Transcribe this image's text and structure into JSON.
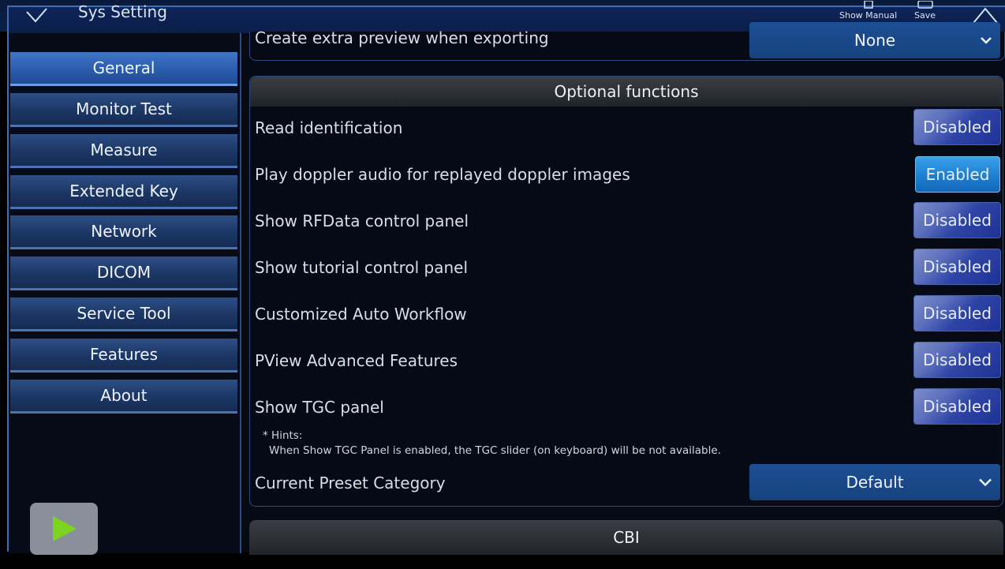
{
  "window": {
    "title": "Sys Setting",
    "show_manual_label": "Show Manual",
    "save_label": "Save"
  },
  "sidebar": {
    "items": [
      {
        "label": "General",
        "active": true
      },
      {
        "label": "Monitor Test"
      },
      {
        "label": "Measure"
      },
      {
        "label": "Extended Key"
      },
      {
        "label": "Network"
      },
      {
        "label": "DICOM"
      },
      {
        "label": "Service Tool"
      },
      {
        "label": "Features"
      },
      {
        "label": "About"
      }
    ]
  },
  "export_row": {
    "label": "Create extra preview when exporting",
    "value": "None"
  },
  "optional_functions": {
    "header": "Optional functions",
    "rows": [
      {
        "label": "Read identification",
        "state": "Disabled"
      },
      {
        "label": "Play doppler audio for replayed doppler images",
        "state": "Enabled"
      },
      {
        "label": "Show RFData control panel",
        "state": "Disabled"
      },
      {
        "label": "Show tutorial control panel",
        "state": "Disabled"
      },
      {
        "label": "Customized Auto Workflow",
        "state": "Disabled"
      },
      {
        "label": "PView Advanced Features",
        "state": "Disabled"
      },
      {
        "label": "Show TGC panel",
        "state": "Disabled"
      }
    ],
    "hint_title": "* Hints:",
    "hint_text": "When Show TGC Panel is enabled, the TGC slider (on keyboard) will be not available.",
    "preset": {
      "label": "Current Preset Category",
      "value": "Default"
    }
  },
  "cbi": {
    "header": "CBI"
  },
  "colors": {
    "accent": "#1e7fd0",
    "nav_active": "#2d5fb0",
    "toggle_disabled": "#2f45a5"
  }
}
